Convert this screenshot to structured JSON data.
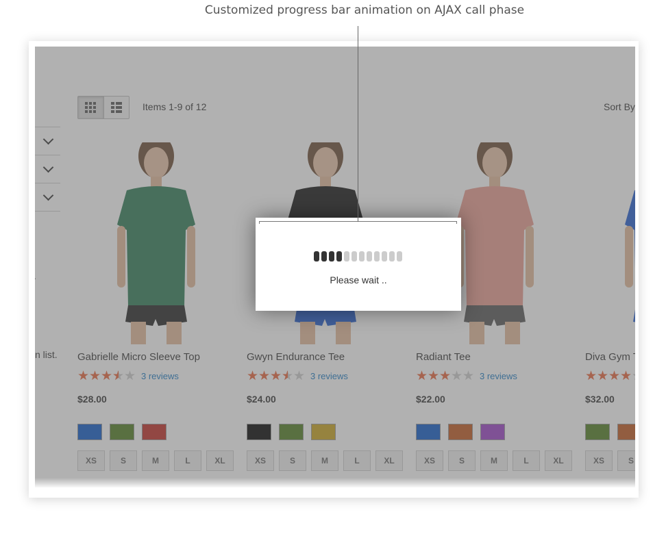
{
  "caption": "Customized progress bar animation on AJAX call phase",
  "toolbar": {
    "items_count": "Items 1-9 of 12",
    "sort_label": "Sort By",
    "grid_mode_icon": "grid-icon",
    "list_mode_icon": "list-icon",
    "active_mode": "grid"
  },
  "sidebar": {
    "filter_icons": [
      "chevron-down-icon",
      "chevron-down-icon",
      "chevron-down-icon"
    ],
    "fragment_1": ".",
    "fragment_2": "n list."
  },
  "products": [
    {
      "name": "Gabrielle Micro Sleeve Top",
      "rating": 3.5,
      "reviews": "3 reviews",
      "price": "$28.00",
      "swatches": [
        "#0a58c8",
        "#4e7d1e",
        "#c02a22"
      ],
      "sizes": [
        "XS",
        "S",
        "M",
        "L",
        "XL"
      ],
      "shirt": "#2d7a54",
      "shorts": "#222222"
    },
    {
      "name": "Gwyn Endurance Tee",
      "rating": 3.5,
      "reviews": "3 reviews",
      "price": "$24.00",
      "swatches": [
        "#000000",
        "#4e7d1e",
        "#c9a31a"
      ],
      "sizes": [
        "XS",
        "S",
        "M",
        "L",
        "XL"
      ],
      "shirt": "#111111",
      "shorts": "#1f5ad1"
    },
    {
      "name": "Radiant Tee",
      "rating": 3,
      "reviews": "3 reviews",
      "price": "$22.00",
      "swatches": [
        "#0a58c8",
        "#c0561c",
        "#9b3fc7"
      ],
      "sizes": [
        "XS",
        "S",
        "M",
        "L",
        "XL"
      ],
      "shirt": "#e99a8f",
      "shorts": "#555555"
    },
    {
      "name": "Diva Gym T",
      "rating": 4,
      "reviews": "",
      "price": "$32.00",
      "swatches": [
        "#4e7d1e",
        "#c0561c"
      ],
      "sizes": [
        "XS",
        "S"
      ],
      "shirt": "#1f5ad1",
      "shorts": "#1f5ad1"
    }
  ],
  "loader": {
    "message": "Please wait ..",
    "progress_segments_total": 12,
    "progress_segments_filled": 4
  },
  "colors": {
    "star_on": "#e8643a",
    "star_off": "#cccccc",
    "link": "#1979c3",
    "overlay": "rgba(100,100,100,0.5)"
  }
}
